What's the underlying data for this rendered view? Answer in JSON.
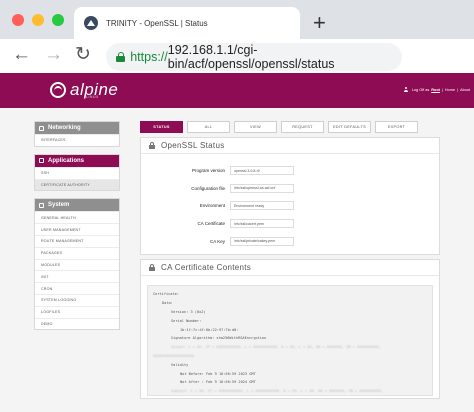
{
  "browser": {
    "tab_title": "TRINITY - OpenSSL | Status",
    "url_scheme": "https://",
    "url_rest": "192.168.1.1/cgi-bin/acf/openssl/openssl/status",
    "new_tab_label": "+",
    "back_label": "←",
    "forward_label": "→",
    "reload_label": "↻",
    "dot_colors": [
      "#ff5f57",
      "#febc2e",
      "#28c840"
    ]
  },
  "header": {
    "logo_text": "alpine",
    "logo_sub": "LINUX",
    "user_prefix": "Log Off as",
    "user_name": "Root",
    "links": [
      "Home",
      "About"
    ],
    "separator": "|",
    "accent": "#8e0c53"
  },
  "sidebar": {
    "sections": [
      {
        "title": "Networking",
        "style": "gray",
        "items": [
          {
            "label": "INTERFACES",
            "active": false
          }
        ]
      },
      {
        "title": "Applications",
        "style": "magenta",
        "items": [
          {
            "label": "SSH",
            "active": false
          },
          {
            "label": "CERTIFICATE AUTHORITY",
            "active": true
          }
        ]
      },
      {
        "title": "System",
        "style": "gray",
        "items": [
          {
            "label": "GENERAL HEALTH",
            "active": false
          },
          {
            "label": "USER MANAGEMENT",
            "active": false
          },
          {
            "label": "ROUTE MANAGEMENT",
            "active": false
          },
          {
            "label": "PACKAGES",
            "active": false
          },
          {
            "label": "MODULES",
            "active": false
          },
          {
            "label": "INIT",
            "active": false
          },
          {
            "label": "CRON",
            "active": false
          },
          {
            "label": "SYSTEM LOGGING",
            "active": false
          },
          {
            "label": "LOGFILES",
            "active": false
          },
          {
            "label": "DEMO",
            "active": false
          }
        ]
      }
    ]
  },
  "tabs": [
    {
      "label": "STATUS",
      "active": true
    },
    {
      "label": "ALL",
      "active": false
    },
    {
      "label": "VIEW",
      "active": false
    },
    {
      "label": "REQUEST",
      "active": false
    },
    {
      "label": "EDIT DEFAULTS",
      "active": false
    },
    {
      "label": "EXPORT",
      "active": false
    }
  ],
  "status_panel": {
    "title": "OpenSSL Status",
    "rows": [
      {
        "key": "Program version",
        "value": "openssl 3.0.8-r0"
      },
      {
        "key": "Configuration file",
        "value": "/etc/ssl/openssl-ca-acf.cnf"
      },
      {
        "key": "Environment",
        "value": "Environment ready"
      },
      {
        "key": "CA Certificate",
        "value": "/etc/ssl/cacert.pem"
      },
      {
        "key": "CA Key",
        "value": "/etc/ssl/private/cakey.pem"
      }
    ]
  },
  "cert_panel": {
    "title": "CA Certificate Contents",
    "lines": [
      {
        "text": "Certificate:",
        "indent": 0,
        "blur": false
      },
      {
        "text": "Data:",
        "indent": 1,
        "blur": false
      },
      {
        "text": "Version: 3 (0x2)",
        "indent": 2,
        "blur": false
      },
      {
        "text": "Serial Number:",
        "indent": 2,
        "blur": false
      },
      {
        "text": "1b:1f:7c:4f:6b:22:97:7b:d0:",
        "indent": 3,
        "blur": false
      },
      {
        "text": "Signature Algorithm: sha256WithRSAEncryption",
        "indent": 2,
        "blur": false
      },
      {
        "text": "Issuer: C = XX, ST = XXXXXXXXXXX, L = XXXXXXXXXXX, O = XX, L = XX, OU = XXXXXXX, CN = XXXXXXXXXX,",
        "indent": 2,
        "blur": true
      },
      {
        "text": "XXXXXXXXXXXXXXXXXXX",
        "indent": 0,
        "blur": true
      },
      {
        "text": "Validity",
        "indent": 2,
        "blur": false
      },
      {
        "text": "Not Before: Feb  9 16:56:59 2023 GMT",
        "indent": 3,
        "blur": false
      },
      {
        "text": "Not After : Feb  9 16:56:59 2024 GMT",
        "indent": 3,
        "blur": false
      },
      {
        "text": "Subject: C = XX, ST = XXXXXXXXXXX, L = XXXXXXXXXXX, O = XX, L = XX, OU = XXXXXXX, CN = XXXXXXXXXX,",
        "indent": 2,
        "blur": true
      },
      {
        "text": "XXXXXXXXXXXXXXXX",
        "indent": 0,
        "blur": true
      }
    ]
  }
}
